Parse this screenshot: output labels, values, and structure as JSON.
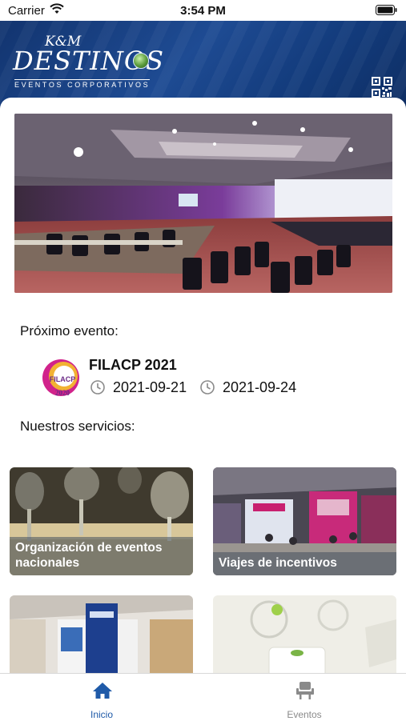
{
  "status": {
    "carrier": "Carrier",
    "time": "3:54 PM"
  },
  "header": {
    "logo_small": "K&M",
    "logo_main": "DESTINOS",
    "logo_sub": "EVENTOS CORPORATIVOS",
    "qr_icon": "qr-code-icon"
  },
  "main": {
    "next_event_label": "Próximo evento:",
    "services_label": "Nuestros servicios:",
    "next_event": {
      "title": "FILACP 2021",
      "start_date": "2021-09-21",
      "end_date": "2021-09-24",
      "logo_text": "FILACP",
      "logo_year": "2020"
    },
    "services": [
      {
        "label": "Organización de eventos nacionales"
      },
      {
        "label": "Viajes de incentivos"
      },
      {
        "label": ""
      },
      {
        "label": ""
      }
    ]
  },
  "tabbar": {
    "items": [
      {
        "label": "Inicio",
        "icon": "home-icon",
        "active": true
      },
      {
        "label": "Eventos",
        "icon": "chair-icon",
        "active": false
      }
    ],
    "active_color": "#1f5aa8",
    "inactive_color": "#8a8a8a"
  },
  "colors": {
    "header_blue": "#1a428a",
    "accent": "#1f5aa8"
  }
}
